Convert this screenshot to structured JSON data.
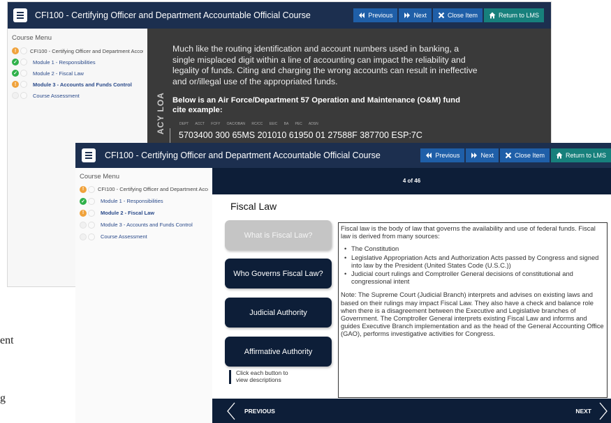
{
  "course_title": "CFI100 - Certifying Officer and Department Accountable Official Course",
  "nav": {
    "previous": "Previous",
    "next": "Next",
    "close": "Close Item",
    "return_lms_back": "Return to LMS",
    "return_lms_front": "Return to LMS"
  },
  "menu": {
    "heading": "Course Menu",
    "back_items": [
      {
        "label": "CFI100 - Certifying Officer and Department Accou",
        "status": "orange"
      },
      {
        "label": "Module 1 - Responsibilities",
        "status": "green"
      },
      {
        "label": "Module 2 - Fiscal Law",
        "status": "green"
      },
      {
        "label": "Module 3 - Accounts and Funds Control",
        "status": "orange"
      },
      {
        "label": "Course Assessment",
        "status": "empty"
      }
    ],
    "front_items": [
      {
        "label": "CFI100 - Certifying Officer and Department Accou",
        "status": "orange"
      },
      {
        "label": "Module 1 - Responsibilities",
        "status": "green"
      },
      {
        "label": "Module 2 - Fiscal Law",
        "status": "orange"
      },
      {
        "label": "Module 3 - Accounts and Funds Control",
        "status": "empty"
      },
      {
        "label": "Course Assessment",
        "status": "empty"
      }
    ]
  },
  "back_content": {
    "paragraph": "Much like the routing identification and account numbers used in banking, a single misplaced digit within a line of accounting can impact the reliability and legality of funds. Citing and charging the wrong accounts can result in ineffective and or/illegal use of the appropriated funds.",
    "heading": "Below is an Air Force/Department 57 Operation and Maintenance (O&M) fund cite example:",
    "loa_label": "ACY LOA",
    "loa_headers": "DEPT ACCT FCFY OAC/OBAN RC/CC EEIC BA PEC ADSN",
    "loa_line": "5703400 300 65MS 201010 61950 01 27588F 387700 ESP:7C"
  },
  "front_content": {
    "page_counter": "4 of 46",
    "title": "Fiscal Law",
    "buttons": [
      "What is Fiscal Law?",
      "Who Governs Fiscal Law?",
      "Judicial Authority",
      "Affirmative Authority"
    ],
    "hint": [
      "Click each button to",
      "view descriptions"
    ],
    "desc_intro": "Fiscal law is the body of law that governs the availability and use of federal funds. Fiscal law is derived from many sources:",
    "desc_bullets": [
      "The Constitution",
      "Legislative Appropriation Acts and Authorization Acts passed by Congress and signed into law by the President (United States Code (U.S.C.))",
      "Judicial court rulings and Comptroller General decisions of constitutional and congressional intent"
    ],
    "desc_note": "Note: The Supreme Court (Judicial Branch) interprets and advises on existing laws and based on their rulings may impact Fiscal Law. They also have a check and balance role when there is a disagreement between the Executive and Legislative branches of Government. The Comptroller General interprets existing Fiscal Law and informs and guides Executive Branch implementation and as the head of the General Accounting Office (GAO), performs investigative activities for Congress.",
    "footer_prev": "PREVIOUS",
    "footer_next": "NEXT"
  },
  "fragments": [
    "ent",
    "g"
  ],
  "colors": {
    "topbar": "#1c2f4f",
    "nav_button": "#1f5fa8",
    "lms_button": "#17807c",
    "dark_navy": "#0d1e38",
    "status_orange": "#f0a23b",
    "status_green": "#2fb14a"
  }
}
